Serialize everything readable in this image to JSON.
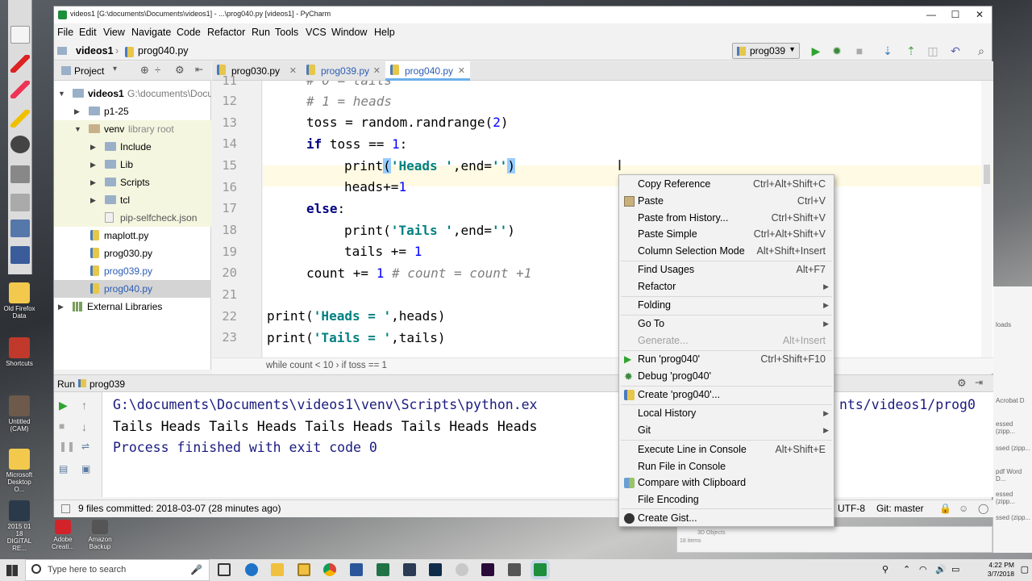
{
  "window": {
    "title": "videos1 [G:\\documents\\Documents\\videos1] - ...\\prog040.py [videos1] - PyCharm",
    "controls": {
      "minimize": "—",
      "maximize": "☐",
      "close": "✕"
    }
  },
  "menubar": [
    "File",
    "Edit",
    "View",
    "Navigate",
    "Code",
    "Refactor",
    "Run",
    "Tools",
    "VCS",
    "Window",
    "Help"
  ],
  "navbar": {
    "project": "videos1",
    "file": "prog040.py",
    "run_config": "prog039"
  },
  "project_panel": {
    "title": "Project",
    "tree": [
      {
        "label": "videos1",
        "hint": "G:\\documents\\Docu"
      },
      {
        "label": "p1-25"
      },
      {
        "label": "venv",
        "hint": "library root"
      },
      {
        "label": "Include"
      },
      {
        "label": "Lib"
      },
      {
        "label": "Scripts"
      },
      {
        "label": "tcl"
      },
      {
        "label": "pip-selfcheck.json"
      },
      {
        "label": "maplott.py"
      },
      {
        "label": "prog030.py"
      },
      {
        "label": "prog039.py"
      },
      {
        "label": "prog040.py"
      },
      {
        "label": "External Libraries"
      }
    ]
  },
  "tabs": [
    "prog030.py",
    "prog039.py",
    "prog040.py"
  ],
  "editor": {
    "line_numbers": [
      "11",
      "12",
      "13",
      "14",
      "15",
      "16",
      "17",
      "18",
      "19",
      "20",
      "21",
      "22",
      "23"
    ],
    "breadcrumb": "while count < 10  ›  if toss == 1"
  },
  "run_panel": {
    "title": "Run",
    "config": "prog039",
    "lines": [
      "G:\\documents\\Documents\\videos1\\venv\\Scripts\\python.ex",
      "Tails Heads Tails Heads Tails Heads Tails Heads Heads",
      "Process finished with exit code 0"
    ],
    "right_fragment": "nts/videos1/prog0"
  },
  "status": {
    "message": "9 files committed: 2018-03-07 (28 minutes ago)",
    "encoding": "UTF-8",
    "vcs": "Git: master"
  },
  "context_menu": [
    {
      "label": "Copy Reference",
      "shortcut": "Ctrl+Alt+Shift+C"
    },
    {
      "label": "Paste",
      "shortcut": "Ctrl+V"
    },
    {
      "label": "Paste from History...",
      "shortcut": "Ctrl+Shift+V"
    },
    {
      "label": "Paste Simple",
      "shortcut": "Ctrl+Alt+Shift+V"
    },
    {
      "label": "Column Selection Mode",
      "shortcut": "Alt+Shift+Insert"
    },
    {
      "label": "Find Usages",
      "shortcut": "Alt+F7"
    },
    {
      "label": "Refactor",
      "shortcut": ""
    },
    {
      "label": "Folding",
      "shortcut": ""
    },
    {
      "label": "Go To",
      "shortcut": ""
    },
    {
      "label": "Generate...",
      "shortcut": "Alt+Insert"
    },
    {
      "label": "Run 'prog040'",
      "shortcut": "Ctrl+Shift+F10"
    },
    {
      "label": "Debug 'prog040'",
      "shortcut": ""
    },
    {
      "label": "Create 'prog040'...",
      "shortcut": ""
    },
    {
      "label": "Local History",
      "shortcut": ""
    },
    {
      "label": "Git",
      "shortcut": ""
    },
    {
      "label": "Execute Line in Console",
      "shortcut": "Alt+Shift+E"
    },
    {
      "label": "Run File in Console",
      "shortcut": ""
    },
    {
      "label": "Compare with Clipboard",
      "shortcut": ""
    },
    {
      "label": "File Encoding",
      "shortcut": ""
    },
    {
      "label": "Create Gist...",
      "shortcut": ""
    }
  ],
  "desktop_icons": [
    "Old Firefox Data",
    "Shortcuts",
    "Untitled (CAM)",
    "Microsoft Desktop O...",
    "2015 01 18 DIGITAL RE...",
    "Adobe Creati...",
    "Amazon Backup"
  ],
  "taskbar": {
    "search_placeholder": "Type here to search",
    "time": "4:22 PM",
    "date": "3/7/2018"
  },
  "behind_window": {
    "items": [
      "loads",
      "Acrobat D",
      "essed (zipp...",
      "ssed (zipp...",
      "pdf Word D...",
      "essed (zipp...",
      "ssed (zipp..."
    ],
    "status": "18 items",
    "folder": "3D Objects"
  },
  "colors": {
    "keyword": "#000080",
    "string": "#008080",
    "comment": "#808080",
    "number": "#0000ff",
    "active_tab": "#6bb0ea",
    "current_line": "#fffae3"
  }
}
